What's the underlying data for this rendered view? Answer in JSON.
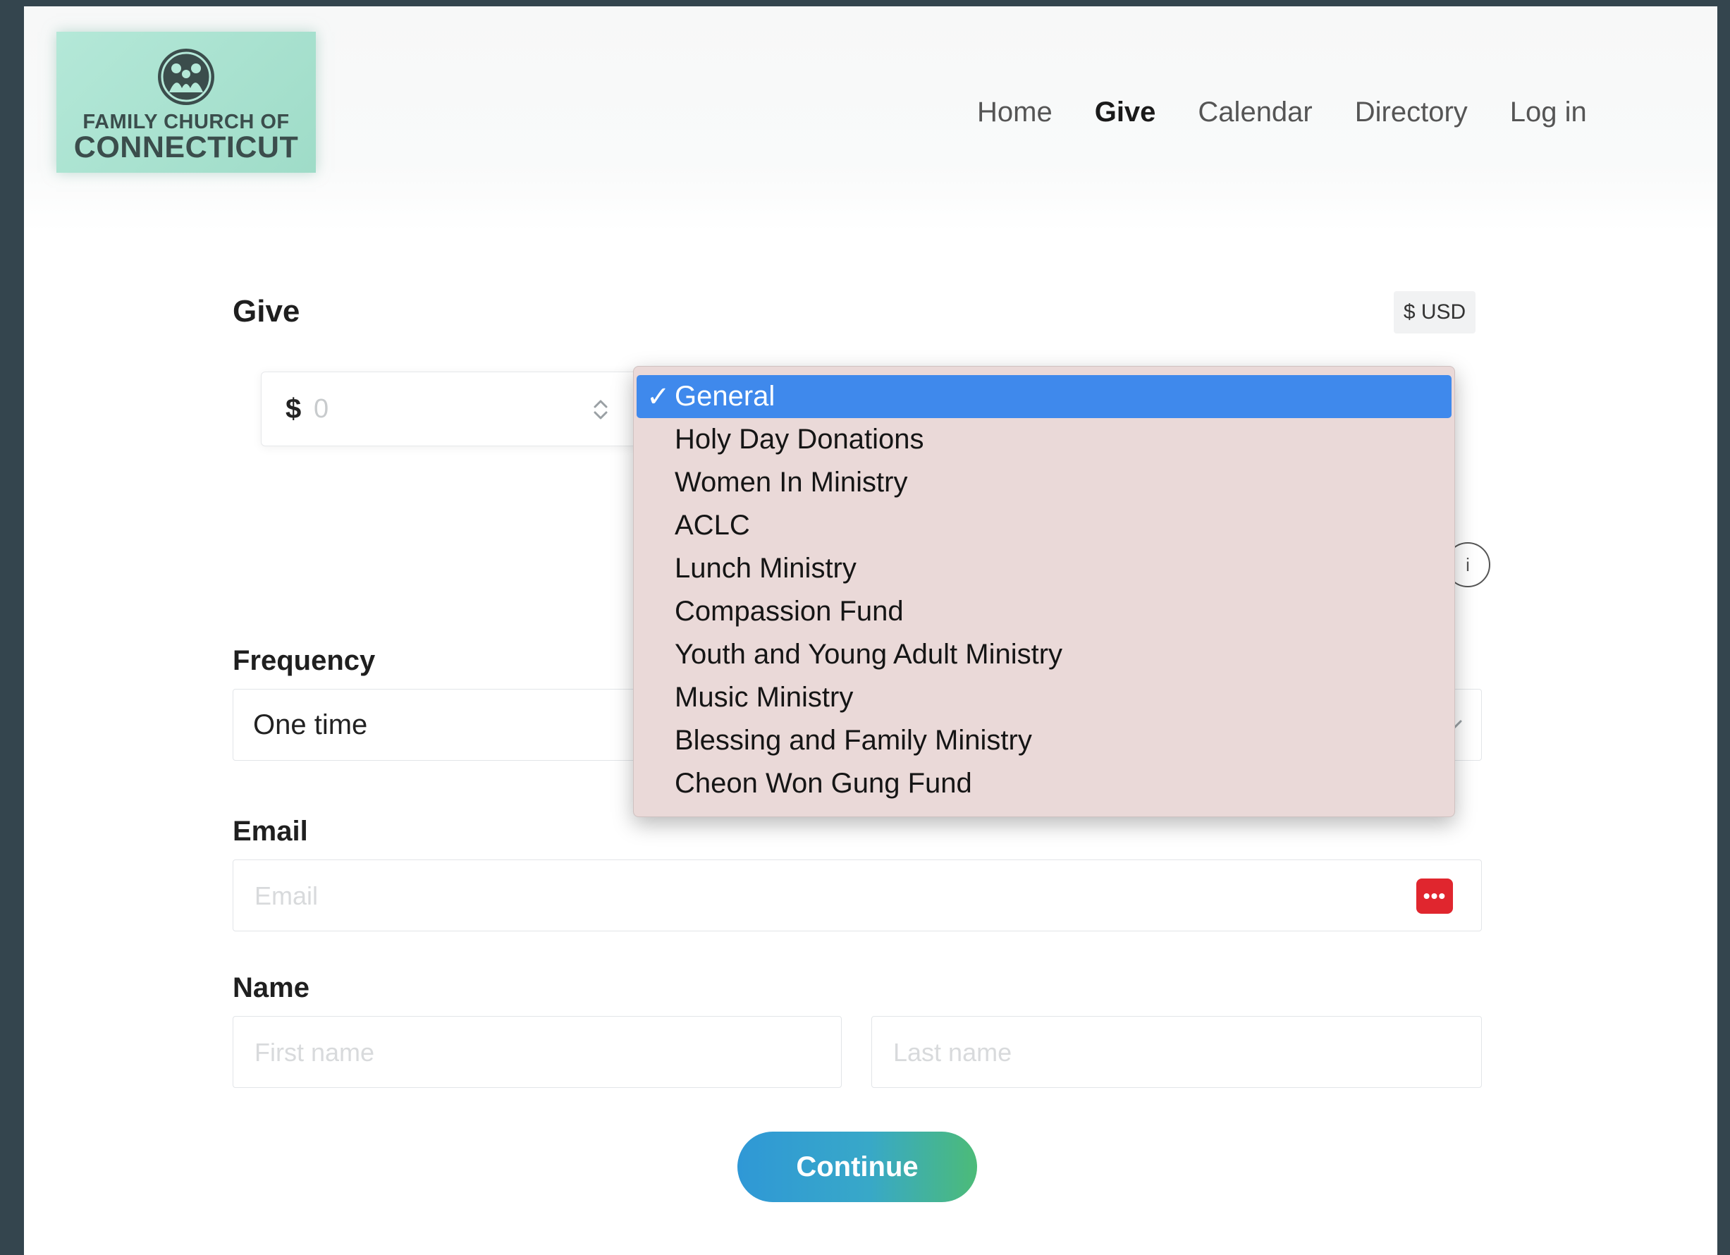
{
  "logo": {
    "line1": "FAMILY CHURCH OF",
    "line2": "CONNECTICUT",
    "emblem_icon": "family-emblem-icon",
    "color": "#b4e8d8"
  },
  "nav": {
    "items": [
      {
        "label": "Home",
        "active": false
      },
      {
        "label": "Give",
        "active": true
      },
      {
        "label": "Calendar",
        "active": false
      },
      {
        "label": "Directory",
        "active": false
      },
      {
        "label": "Log in",
        "active": false
      }
    ]
  },
  "form": {
    "title": "Give",
    "currency": "$ USD",
    "amount": {
      "symbol": "$",
      "placeholder": "0",
      "value": ""
    },
    "fund_dropdown": {
      "selected": "General",
      "check_mark": "✓",
      "options": [
        "General",
        "Holy Day Donations",
        "Women In Ministry",
        "ACLC",
        "Lunch Ministry",
        "Compassion Fund",
        "Youth and Young Adult Ministry",
        "Music Ministry",
        "Blessing and Family Ministry",
        "Cheon Won Gung Fund"
      ],
      "highlight_color": "#3f89ec"
    },
    "info_glyph": "i",
    "frequency": {
      "label": "Frequency",
      "value": "One time"
    },
    "email": {
      "label": "Email",
      "placeholder": "Email",
      "password_manager_glyph": "•••"
    },
    "name": {
      "label": "Name",
      "first_placeholder": "First name",
      "last_placeholder": "Last name"
    },
    "continue_label": "Continue"
  },
  "colors": {
    "background": "#34454e",
    "button_gradient_start": "#2f98d6",
    "button_gradient_end": "#4cbb78",
    "password_manager": "#e0262e"
  }
}
